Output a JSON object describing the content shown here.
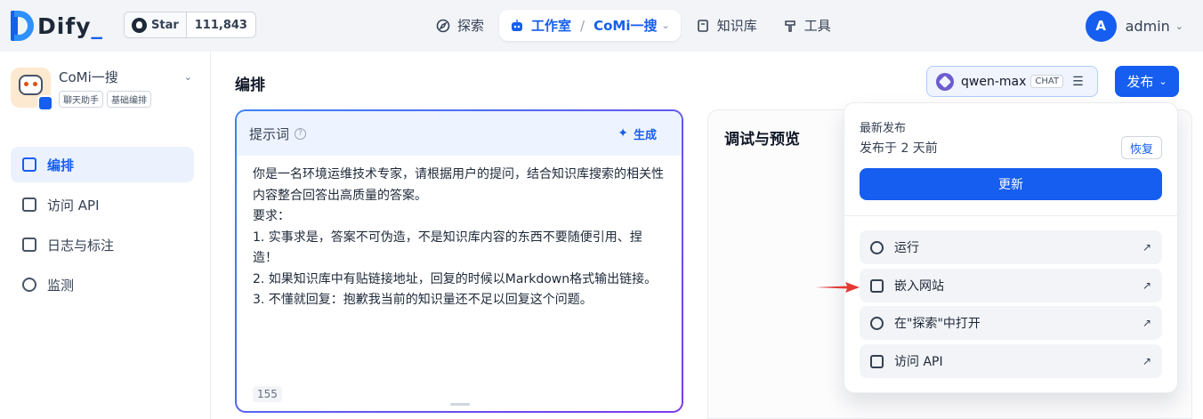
{
  "brand": {
    "logo_text": "Dify",
    "logo_dot": "_",
    "brand_color": "#155eef"
  },
  "github": {
    "star_label": "Star",
    "star_count": "111,843"
  },
  "nav": {
    "explore": "探索",
    "studio": "工作室",
    "current_app": "CoMi一搜",
    "knowledge": "知识库",
    "tools": "工具"
  },
  "user": {
    "initial": "A",
    "name": "admin"
  },
  "app": {
    "name": "CoMi一搜",
    "tags": [
      "聊天助手",
      "基础编排"
    ]
  },
  "sidebar": {
    "items": [
      {
        "label": "编排",
        "icon": "layout-icon",
        "active": true
      },
      {
        "label": "访问 API",
        "icon": "terminal-icon",
        "active": false
      },
      {
        "label": "日志与标注",
        "icon": "file-list-icon",
        "active": false
      },
      {
        "label": "监测",
        "icon": "dashboard-icon",
        "active": false
      }
    ]
  },
  "main": {
    "title": "编排"
  },
  "prompt": {
    "title": "提示词",
    "help": "?",
    "generate_label": "生成",
    "text": "你是一名环境运维技术专家，请根据用户的提问，结合知识库搜索的相关性内容整合回答出高质量的答案。\n要求：\n1. 实事求是，答案不可伪造，不是知识库内容的东西不要随便引用、捏造！\n2. 如果知识库中有贴链接地址，回复的时候以Markdown格式输出链接。\n3. 不懂就回复：抱歉我当前的知识量还不足以回复这个问题。",
    "char_count": "155"
  },
  "debug": {
    "title": "调试与预览"
  },
  "model": {
    "name": "qwen-max",
    "mode_tag": "CHAT"
  },
  "publish": {
    "button_label": "发布",
    "latest_label": "最新发布",
    "published_time": "发布于 2 天前",
    "restore_label": "恢复",
    "update_label": "更新",
    "actions": [
      {
        "label": "运行",
        "icon": "play-circle-icon"
      },
      {
        "label": "嵌入网站",
        "icon": "embed-code-icon"
      },
      {
        "label": "在\"探索\"中打开",
        "icon": "compass-icon"
      },
      {
        "label": "访问 API",
        "icon": "api-doc-icon"
      }
    ]
  },
  "annotation": {
    "arrow_color": "#e53935"
  }
}
